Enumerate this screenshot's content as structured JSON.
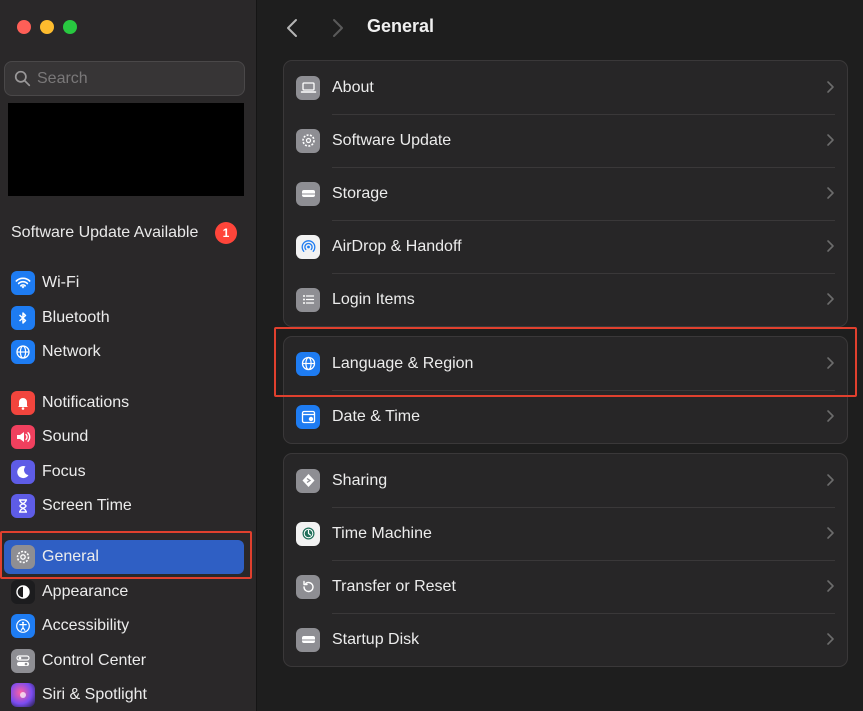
{
  "window": {
    "title": "General",
    "traffic_lights": {
      "close": "#fe5f57",
      "minimize": "#febc2e",
      "zoom": "#28c840"
    }
  },
  "sidebar": {
    "search": {
      "placeholder": "Search",
      "value": ""
    },
    "update": {
      "label": "Software Update Available",
      "badge": "1"
    },
    "items": [
      {
        "label": "Wi-Fi",
        "icon": "wifi-icon",
        "color": "#1e7cf2"
      },
      {
        "label": "Bluetooth",
        "icon": "bluetooth-icon",
        "color": "#1e7cf2"
      },
      {
        "label": "Network",
        "icon": "globe-icon",
        "color": "#1e7cf2"
      },
      {
        "label": "Notifications",
        "icon": "bell-icon",
        "color": "#f2453d"
      },
      {
        "label": "Sound",
        "icon": "speaker-icon",
        "color": "#f0405e"
      },
      {
        "label": "Focus",
        "icon": "moon-icon",
        "color": "#5e5ce6"
      },
      {
        "label": "Screen Time",
        "icon": "hourglass-icon",
        "color": "#5e5ce6"
      },
      {
        "label": "General",
        "icon": "gear-icon",
        "color": "#8e8e93",
        "selected": true
      },
      {
        "label": "Appearance",
        "icon": "appearance-icon",
        "color": "#1c1c1e"
      },
      {
        "label": "Accessibility",
        "icon": "accessibility-icon",
        "color": "#1e7cf2"
      },
      {
        "label": "Control Center",
        "icon": "control-center-icon",
        "color": "#8e8e93"
      },
      {
        "label": "Siri & Spotlight",
        "icon": "siri-icon",
        "color": "#7a4cf0"
      }
    ]
  },
  "main": {
    "title": "General",
    "groups": [
      [
        {
          "label": "About",
          "icon": "laptop-icon"
        },
        {
          "label": "Software Update",
          "icon": "gear-update-icon"
        },
        {
          "label": "Storage",
          "icon": "storage-icon"
        },
        {
          "label": "AirDrop & Handoff",
          "icon": "airdrop-icon"
        },
        {
          "label": "Login Items",
          "icon": "list-icon"
        }
      ],
      [
        {
          "label": "Language & Region",
          "icon": "globe-icon"
        },
        {
          "label": "Date & Time",
          "icon": "calendar-icon"
        }
      ],
      [
        {
          "label": "Sharing",
          "icon": "sharing-icon"
        },
        {
          "label": "Time Machine",
          "icon": "time-machine-icon"
        },
        {
          "label": "Transfer or Reset",
          "icon": "reset-icon"
        },
        {
          "label": "Startup Disk",
          "icon": "disk-icon"
        }
      ]
    ],
    "highlight_color": "#e0402e"
  }
}
